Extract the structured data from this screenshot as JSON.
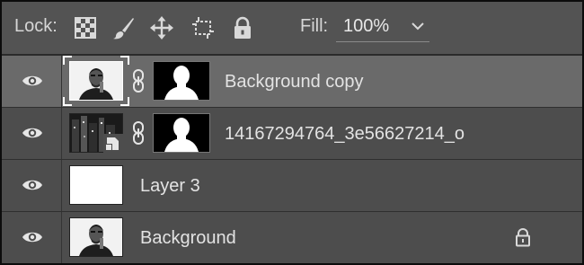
{
  "lockbar": {
    "lock_label": "Lock:",
    "buttons": [
      {
        "name": "lock-transparent-pixels",
        "icon": "checkerboard-icon"
      },
      {
        "name": "lock-image-pixels",
        "icon": "brush-icon"
      },
      {
        "name": "lock-position",
        "icon": "move-icon"
      },
      {
        "name": "lock-artboard",
        "icon": "artboard-icon"
      },
      {
        "name": "lock-all",
        "icon": "lock-icon"
      }
    ],
    "fill_label": "Fill:",
    "fill_value": "100%"
  },
  "layers": [
    {
      "name": "Background copy",
      "selected": true,
      "has_mask": true,
      "thumb": "portrait",
      "smart_object": false,
      "locked": false
    },
    {
      "name": "14167294764_3e56627214_o",
      "selected": false,
      "has_mask": true,
      "thumb": "city",
      "smart_object": true,
      "locked": false
    },
    {
      "name": "Layer 3",
      "selected": false,
      "has_mask": false,
      "thumb": "blank",
      "smart_object": false,
      "locked": false
    },
    {
      "name": "Background",
      "selected": false,
      "has_mask": false,
      "thumb": "portrait",
      "smart_object": false,
      "locked": true
    }
  ],
  "colors": {
    "toolbar_bg": "#535353",
    "row_bg": "#4d4d4d",
    "row_selected_bg": "#6a6a6a",
    "text": "#e3e3e3"
  }
}
